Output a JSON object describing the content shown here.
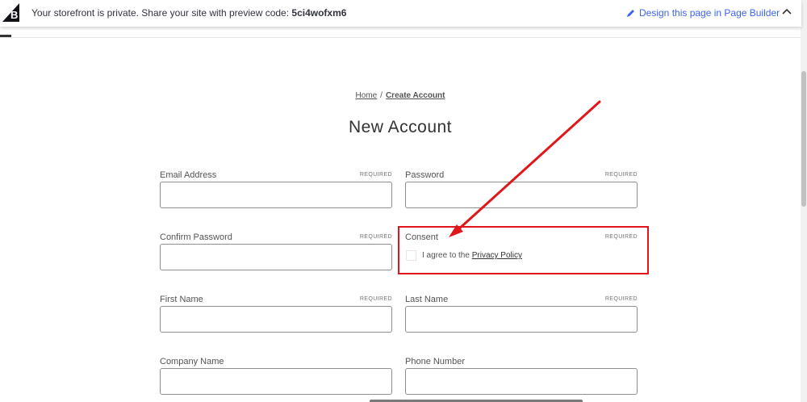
{
  "banner": {
    "message": "Your storefront is private. Share your site with preview code: ",
    "code": "5ci4wofxm6",
    "design_link": "Design this page in Page Builder"
  },
  "breadcrumb": {
    "home": "Home",
    "separator": "/",
    "current": "Create Account"
  },
  "page_title": "New Account",
  "form": {
    "email": {
      "label": "Email Address",
      "required": "REQUIRED"
    },
    "password": {
      "label": "Password",
      "required": "REQUIRED"
    },
    "confirm_password": {
      "label": "Confirm Password",
      "required": "REQUIRED"
    },
    "consent": {
      "label": "Consent",
      "required": "REQUIRED",
      "checkbox_text": "I agree to the ",
      "link": "Privacy Policy"
    },
    "first_name": {
      "label": "First Name",
      "required": "REQUIRED"
    },
    "last_name": {
      "label": "Last Name",
      "required": "REQUIRED"
    },
    "company_name": {
      "label": "Company Name"
    },
    "phone_number": {
      "label": "Phone Number"
    }
  },
  "colors": {
    "annotation": "#e0161b",
    "link": "#3c64f4"
  },
  "icons": [
    "bigcommerce-logo-icon",
    "pencil-icon",
    "chevron-up-icon"
  ]
}
